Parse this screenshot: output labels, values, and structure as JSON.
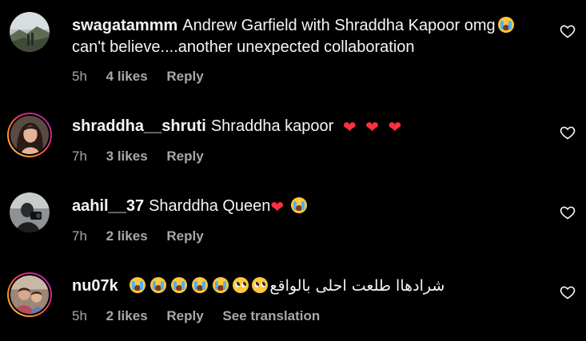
{
  "comments": [
    {
      "username": "swagatammm",
      "text": "Andrew Garfield with Shraddha Kapoor omg",
      "text2": "can't believe....another unexpected collaboration",
      "time": "5h",
      "likes": "4 likes",
      "reply": "Reply",
      "avatar_icon": "landscape-photo-avatar"
    },
    {
      "username": "shraddha__shruti",
      "text": "Shraddha kapoor",
      "time": "7h",
      "likes": "3 likes",
      "reply": "Reply",
      "avatar_icon": "woman-portrait-avatar"
    },
    {
      "username": "aahil__37",
      "text": "Sharddha Queen",
      "time": "7h",
      "likes": "2 likes",
      "reply": "Reply",
      "avatar_icon": "camera-person-avatar"
    },
    {
      "username": "nu07k",
      "text": "شرادهاا طلعت احلى بالواقع",
      "time": "5h",
      "likes": "2 likes",
      "reply": "Reply",
      "translate": "See translation",
      "avatar_icon": "children-photo-avatar"
    }
  ],
  "icons": {
    "like": "heart-outline-icon",
    "heart_emoji": "red-heart-emoji",
    "cry_emoji": "loudly-crying-face-emoji",
    "plead_emoji": "pleading-face-emoji"
  },
  "colors": {
    "background": "#000000",
    "text": "#f5f5f5",
    "meta": "#a8a8a8",
    "heart": "#ff3040"
  }
}
